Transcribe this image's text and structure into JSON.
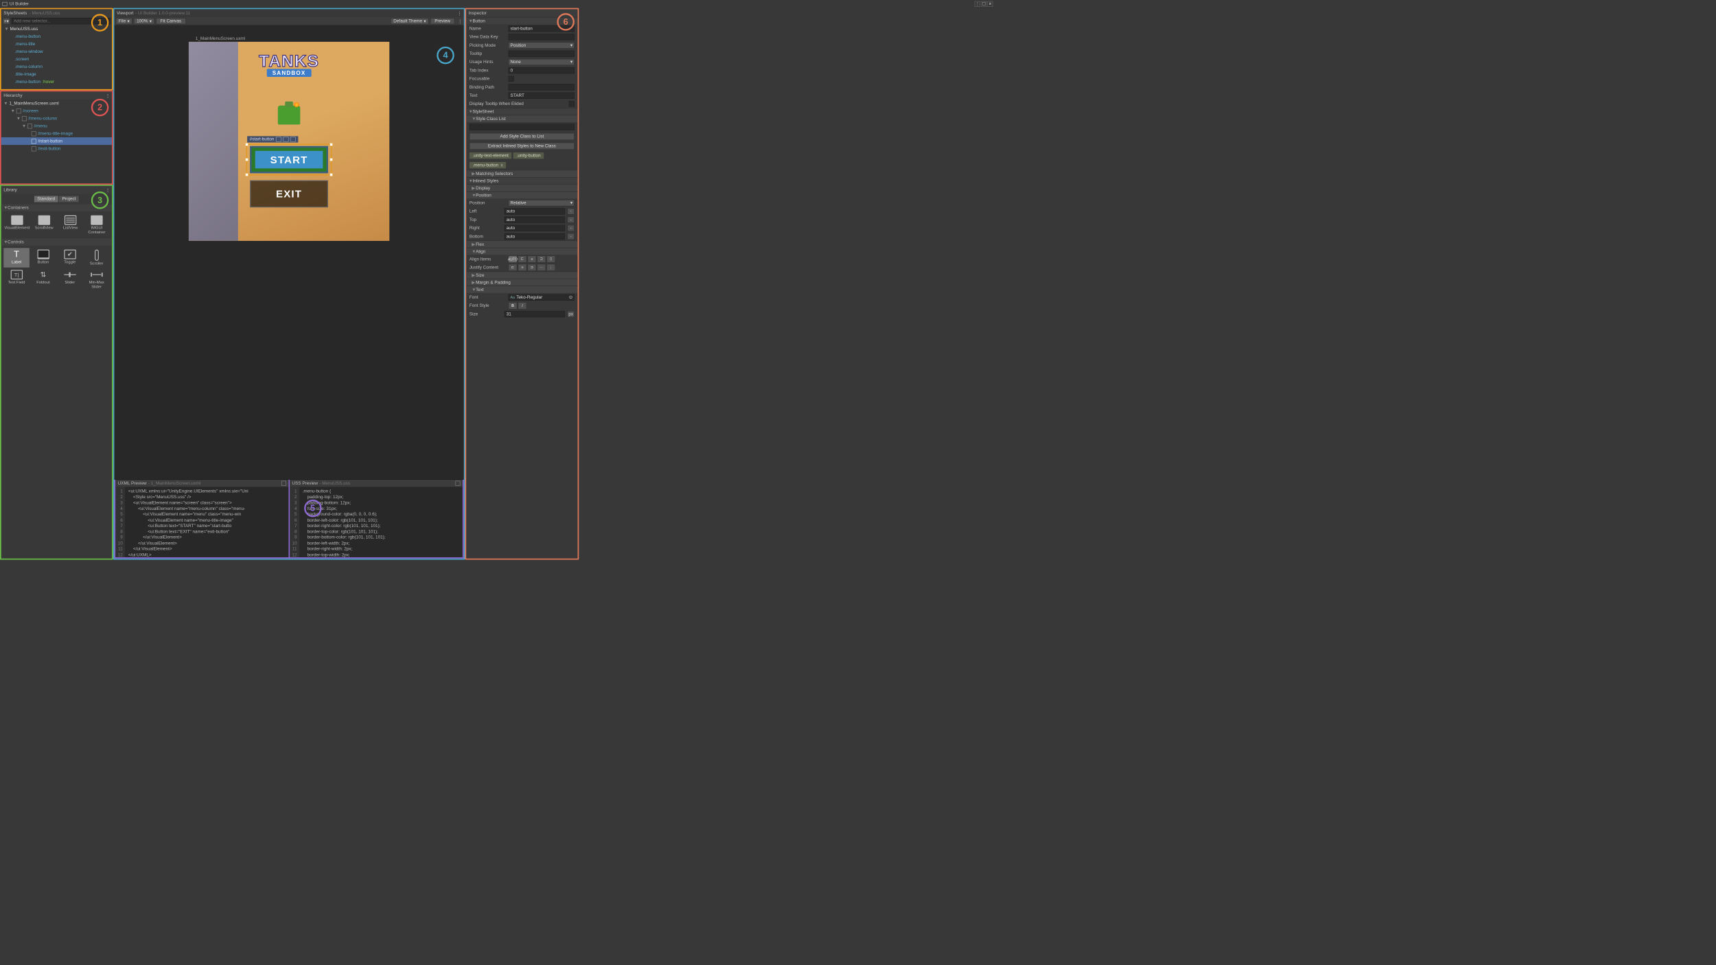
{
  "window": {
    "title": "UI Builder"
  },
  "callouts": {
    "c1": "1",
    "c2": "2",
    "c3": "3",
    "c4": "4",
    "c5": "5",
    "c6": "6"
  },
  "stylesheets": {
    "title": "StyleSheets",
    "subtitle": "- MenuUSS.uss",
    "add_placeholder": "Add new selector...",
    "file": "MenuUSS.uss",
    "selectors": [
      ".menu-button",
      ".menu-title",
      ".menu-window",
      ".screen",
      ".menu-column",
      ".title-image"
    ],
    "hover_base": ".menu-button",
    "hover_state": ":hover"
  },
  "hierarchy": {
    "title": "Hierarchy",
    "file": "1_MainMenuScreen.uxml",
    "nodes": {
      "screen": "#screen",
      "menu_column": "#menu-column",
      "menu": "#menu",
      "title_image": "#menu-title-image",
      "start_button": "#start-button",
      "exit_button": "#exit-button"
    }
  },
  "library": {
    "title": "Library",
    "tabs": {
      "standard": "Standard",
      "project": "Project"
    },
    "containers_label": "Containers",
    "controls_label": "Controls",
    "containers": [
      "VisualElement",
      "ScrollView",
      "ListView",
      "IMGUI Container"
    ],
    "controls": [
      "Label",
      "Button",
      "Toggle",
      "Scroller",
      "Text Field",
      "Foldout",
      "Slider",
      "Min-Max Slider"
    ]
  },
  "viewport": {
    "title": "Viewport",
    "subtitle": "- UI Builder 1.0.0-preview.11",
    "file_menu": "File",
    "zoom": "100%",
    "fit_canvas": "Fit Canvas",
    "theme": "Default Theme",
    "preview": "Preview",
    "canvas_file": "1_MainMenuScreen.uxml",
    "selection_tag": "#start-button",
    "game": {
      "title": "TANKS",
      "subtitle": "SANDBOX",
      "start": "START",
      "exit": "EXIT"
    }
  },
  "previews": {
    "uxml": {
      "title": "UXML Preview",
      "subtitle": "- 1_MainMenuScreen.uxml",
      "lines": [
        "1",
        "2",
        "3",
        "4",
        "5",
        "6",
        "7",
        "8",
        "9",
        "10",
        "11",
        "12"
      ],
      "code": "<ui:UXML xmlns:ui=\"UnityEngine.UIElements\" xmlns:uie=\"Uni\n    <Style src=\"MenuUSS.uss\" />\n    <ui:VisualElement name=\"screen\" class=\"screen\">\n        <ui:VisualElement name=\"menu-column\" class=\"menu-\n            <ui:VisualElement name=\"menu\" class=\"menu-win\n                <ui:VisualElement name=\"menu-title-image\"\n                <ui:Button text=\"START\" name=\"start-butto\n                <ui:Button text=\"EXIT\" name=\"exit-button\"\n            </ui:VisualElement>\n        </ui:VisualElement>\n    </ui:VisualElement>\n</ui:UXML>"
    },
    "uss": {
      "title": "USS Preview",
      "subtitle": "- MenuUSS.uss",
      "lines": [
        "1",
        "2",
        "3",
        "4",
        "5",
        "6",
        "7",
        "8",
        "9",
        "10",
        "11",
        "12"
      ],
      "code": ".menu-button {\n    padding-top: 12px;\n    padding-bottom: 12px;\n    font-size: 31px;\n    background-color: rgba(0, 0, 0, 0.6);\n    border-left-color: rgb(101, 101, 101);\n    border-right-color: rgb(101, 101, 101);\n    border-top-color: rgb(101, 101, 101);\n    border-bottom-color: rgb(101, 101, 101);\n    border-left-width: 2px;\n    border-right-width: 2px;\n    border-top-width: 2px;"
    }
  },
  "inspector": {
    "title": "Inspector",
    "section_button": "Button",
    "fields": {
      "name_l": "Name",
      "name_v": "start-button",
      "vdk_l": "View Data Key",
      "pm_l": "Picking Mode",
      "pm_v": "Position",
      "tooltip_l": "Tooltip",
      "uh_l": "Usage Hints",
      "uh_v": "None",
      "ti_l": "Tab Index",
      "ti_v": "0",
      "foc_l": "Focusable",
      "bp_l": "Binding Path",
      "text_l": "Text",
      "text_v": "START",
      "dtwe_l": "Display Tooltip When Elided"
    },
    "stylesheet_label": "StyleSheet",
    "scl_label": "Style Class List",
    "add_class_btn": "Add Style Class to List",
    "extract_btn": "Extract Inlined Styles to New Class",
    "chips": {
      "ute": ".unity-text-element",
      "ub": ".unity-button",
      "mb": ".menu-button"
    },
    "matching_label": "Matching Selectors",
    "inlined_label": "Inlined Styles",
    "display_label": "Display",
    "position": {
      "label": "Position",
      "pos_l": "Position",
      "pos_v": "Relative",
      "left_l": "Left",
      "left_v": "auto",
      "top_l": "Top",
      "top_v": "auto",
      "right_l": "Right",
      "right_v": "auto",
      "bottom_l": "Bottom",
      "bottom_v": "auto"
    },
    "flex_label": "Flex",
    "align": {
      "label": "Align",
      "ai": "Align Items",
      "ai_auto": "AUTO",
      "jc": "Justify Content"
    },
    "size_label": "Size",
    "mp_label": "Margin & Padding",
    "text": {
      "label": "Text",
      "font_l": "Font",
      "font_v": "Teko-Regular",
      "fs_l": "Font Style",
      "size_l": "Size",
      "size_v": "31",
      "size_u": "px"
    }
  }
}
